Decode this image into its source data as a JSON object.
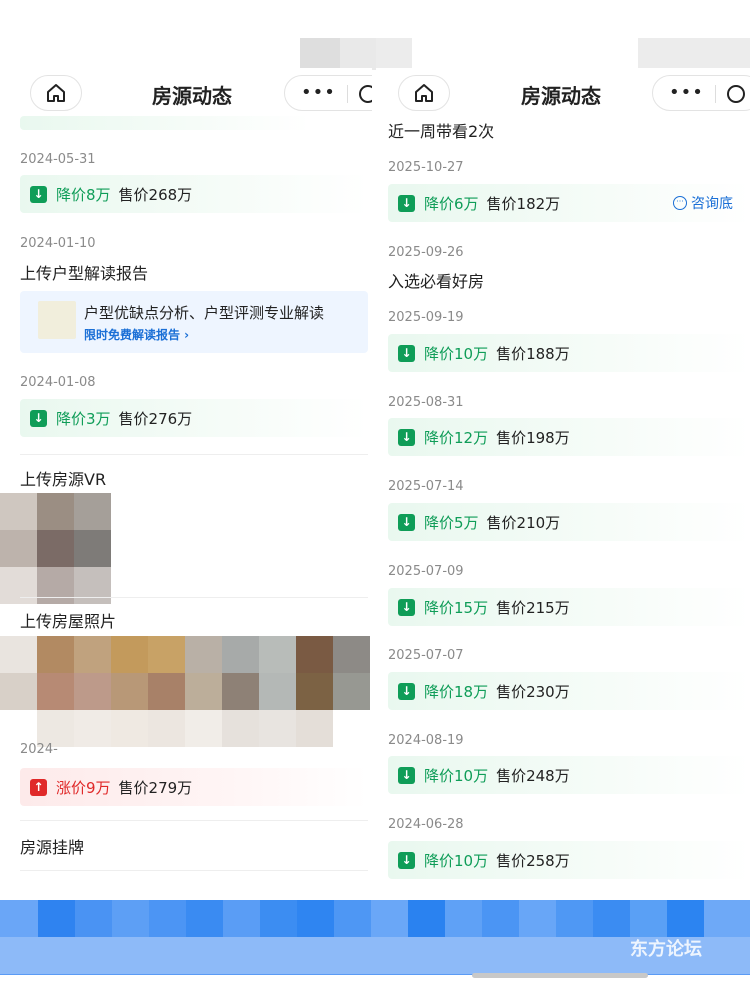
{
  "left_panel": {
    "title": "房源动态",
    "records": [
      {
        "date": "2024-05-31",
        "change": "降价8万",
        "sale": "售价268万",
        "direction": "down"
      },
      {
        "date": "2024-01-10",
        "event": "上传户型解读报告"
      },
      {
        "date": "2024-01-08",
        "change": "降价3万",
        "sale": "售价276万",
        "direction": "down"
      },
      {
        "event": "上传房源VR"
      },
      {
        "event": "上传房屋照片"
      },
      {
        "date": "2024-",
        "change": "涨价9万",
        "sale": "售价279万",
        "direction": "up"
      },
      {
        "event": "房源挂牌"
      }
    ],
    "report": {
      "text": "户型优缺点分析、户型评测专业解读",
      "link": "限时免费解读报告 ›"
    }
  },
  "right_panel": {
    "title": "房源动态",
    "top_event": "近一周带看2次",
    "consult": "咨询底",
    "records": [
      {
        "date": "2025-10-27",
        "change": "降价6万",
        "sale": "售价182万",
        "direction": "down"
      },
      {
        "date": "2025-09-26",
        "event": "入选必看好房"
      },
      {
        "date": "2025-09-19",
        "change": "降价10万",
        "sale": "售价188万",
        "direction": "down"
      },
      {
        "date": "2025-08-31",
        "change": "降价12万",
        "sale": "售价198万",
        "direction": "down"
      },
      {
        "date": "2025-07-14",
        "change": "降价5万",
        "sale": "售价210万",
        "direction": "down"
      },
      {
        "date": "2025-07-09",
        "change": "降价15万",
        "sale": "售价215万",
        "direction": "down"
      },
      {
        "date": "2025-07-07",
        "change": "降价18万",
        "sale": "售价230万",
        "direction": "down"
      },
      {
        "date": "2024-08-19",
        "change": "降价10万",
        "sale": "售价248万",
        "direction": "down"
      },
      {
        "date": "2024-06-28",
        "change": "降价10万",
        "sale": "售价258万",
        "direction": "down"
      }
    ]
  },
  "watermark": "东方论坛",
  "icons": {
    "home": "home-icon",
    "menu": "more-dots-icon",
    "capsule": "close-circle-icon",
    "down": "down-arrow-icon",
    "up": "up-arrow-icon",
    "consult": "chat-bubble-icon"
  },
  "colors": {
    "drop": "#0f9d58",
    "rise": "#e02929",
    "link": "#1a6fd6"
  }
}
